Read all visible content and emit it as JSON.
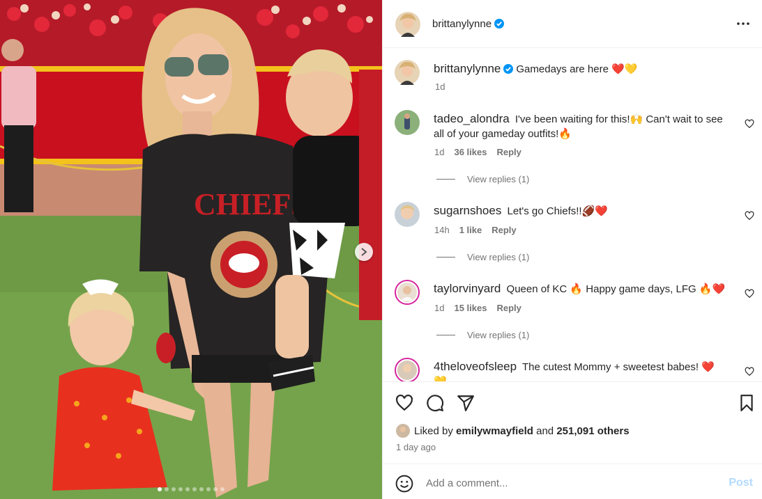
{
  "post": {
    "author": "brittanylynne",
    "caption_username": "brittanylynne",
    "caption_text": "Gamedays are here ❤️💛",
    "caption_time": "1d"
  },
  "comments": [
    {
      "username": "tadeo_alondra",
      "text": "I've been waiting for this!🙌 Can't wait to see all of your gameday outfits!🔥",
      "time": "1d",
      "likes": "36 likes",
      "reply": "Reply",
      "view_replies": "View replies (1)"
    },
    {
      "username": "sugarnshoes",
      "text": "Let's go Chiefs!!🏈❤️",
      "time": "14h",
      "likes": "1 like",
      "reply": "Reply",
      "view_replies": "View replies (1)"
    },
    {
      "username": "taylorvinyard",
      "text": "Queen of KC 🔥 Happy game days, LFG 🔥❤️",
      "time": "1d",
      "likes": "15 likes",
      "reply": "Reply",
      "view_replies": "View replies (1)"
    },
    {
      "username": "4theloveofsleep",
      "text": "The cutest Mommy + sweetest babes! ❤️💛"
    }
  ],
  "likes": {
    "prefix": "Liked by",
    "user": "emilywmayfield",
    "joiner": "and",
    "count": "251,091 others"
  },
  "timestamp": "1 day ago",
  "add_comment": {
    "placeholder": "Add a comment...",
    "post_label": "Post"
  },
  "photo": {
    "shirt_text": "Kansas City CHIEFS",
    "carousel_total": 10,
    "carousel_active": 1
  },
  "colors": {
    "verified": "#0095f6",
    "post_disabled": "#b3dbff",
    "chiefs_red": "#d3122c"
  },
  "icons": [
    "verified-badge-icon",
    "more-options-icon",
    "heart-icon",
    "comment-icon",
    "share-icon",
    "bookmark-icon",
    "emoji-icon",
    "chevron-right-icon"
  ]
}
